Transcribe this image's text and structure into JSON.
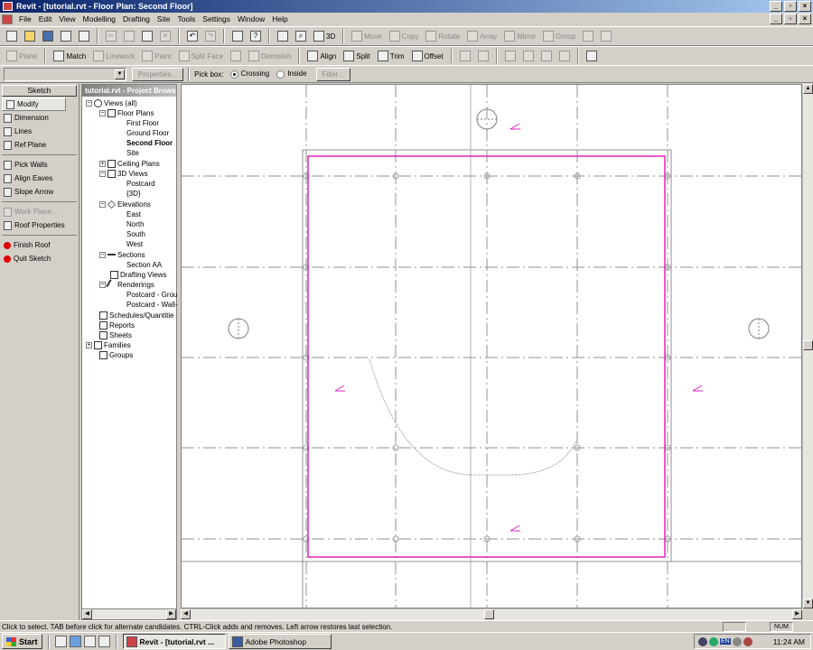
{
  "window": {
    "title": "Revit - [tutorial.rvt - Floor Plan: Second Floor]"
  },
  "menu": [
    "File",
    "Edit",
    "View",
    "Modelling",
    "Drafting",
    "Site",
    "Tools",
    "Settings",
    "Window",
    "Help"
  ],
  "toolbar1": {
    "view_3d": "3D",
    "move": "Move",
    "copy": "Copy",
    "rotate": "Rotate",
    "array": "Array",
    "mirror": "Mirror",
    "group": "Group"
  },
  "toolbar2": {
    "plane": "Plane",
    "match": "Match",
    "linework": "Linework",
    "paint": "Paint",
    "split_face": "Split Face",
    "demolish": "Demolish",
    "align": "Align",
    "split": "Split",
    "trim": "Trim",
    "offset": "Offset"
  },
  "options_bar": {
    "properties": "Properties...",
    "pick_box": "Pick box:",
    "crossing": "Crossing",
    "inside": "Inside",
    "filter": "Filter..."
  },
  "designbar": {
    "header": "Sketch",
    "items": [
      "Modify",
      "Dimension",
      "Lines",
      "Ref Plane",
      "Pick Walls",
      "Align Eaves",
      "Slope Arrow",
      "Work Plane...",
      "Roof Properties",
      "Finish Roof",
      "Quit Sketch"
    ]
  },
  "browser": {
    "title": "tutorial.rvt - Project Browser",
    "nodes": [
      "Views (all)",
      "Floor Plans",
      "First Floor",
      "Ground Floor",
      "Second Floor",
      "Site",
      "Ceiling Plans",
      "3D Views",
      "Postcard",
      "{3D}",
      "Elevations",
      "East",
      "North",
      "South",
      "West",
      "Sections",
      "Section AA",
      "Drafting Views",
      "Renderings",
      "Postcard - Grou",
      "Postcard - Wall-",
      "Schedules/Quantitie",
      "Reports",
      "Sheets",
      "Families",
      "Groups"
    ]
  },
  "status": {
    "message": "Click to select. TAB before click for alternate candidates. CTRL-Click adds and removes. Left arrow restores last selection.",
    "num": "NUM"
  },
  "taskbar": {
    "start": "Start",
    "task1": "Revit - [tutorial.rvt ...",
    "task2": "Adobe Photoshop",
    "lang": "EN",
    "clock": "11:24 AM"
  },
  "colors": {
    "sketch_magenta": "#e020c0",
    "grid_line": "#909090",
    "title_blue": "#0a246a"
  }
}
